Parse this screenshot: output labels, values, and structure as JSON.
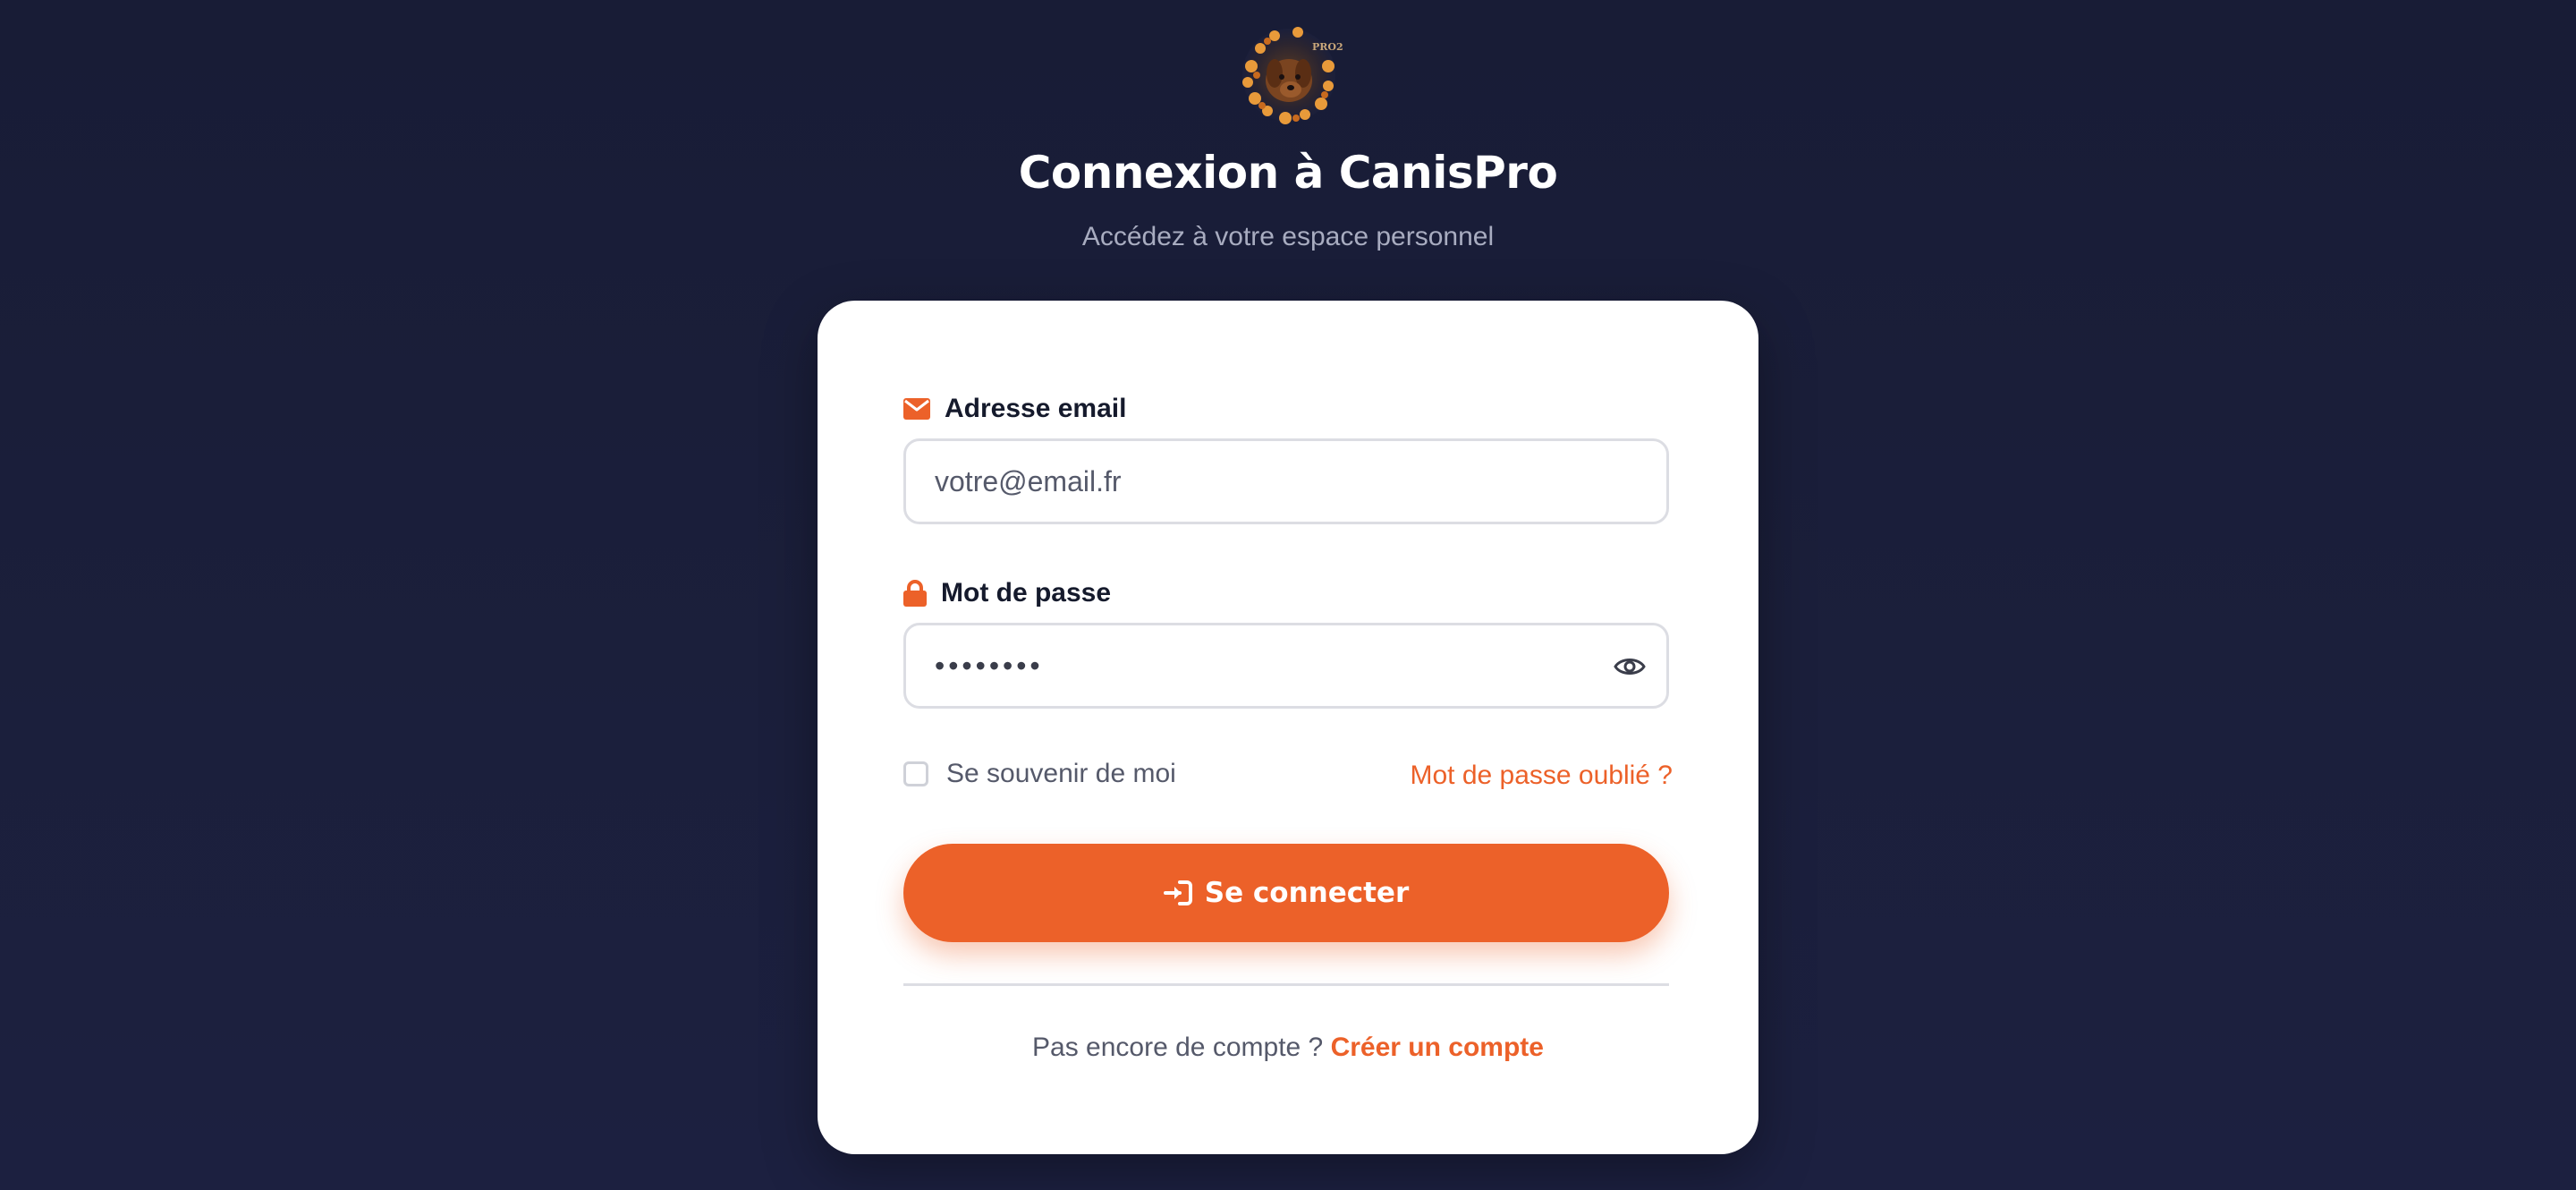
{
  "header": {
    "title": "Connexion à CanisPro",
    "subtitle": "Accédez à votre espace personnel",
    "logo_text": "PRO2"
  },
  "form": {
    "email": {
      "label": "Adresse email",
      "placeholder": "votre@email.fr",
      "icon": "envelope-icon"
    },
    "password": {
      "label": "Mot de passe",
      "value": "••••••••",
      "icon": "lock-icon",
      "toggle_icon": "eye-icon"
    },
    "remember_label": "Se souvenir de moi",
    "remember_checked": false,
    "forgot_label": "Mot de passe oublié ?",
    "submit_label": "Se connecter",
    "submit_icon": "sign-in-icon"
  },
  "footer": {
    "prompt": "Pas encore de compte ?",
    "link_label": "Créer un compte"
  },
  "colors": {
    "accent": "#ec6129",
    "background": "#1b1f3b",
    "card": "#ffffff",
    "text_dark": "#151a2c",
    "text_muted": "#55596a"
  }
}
